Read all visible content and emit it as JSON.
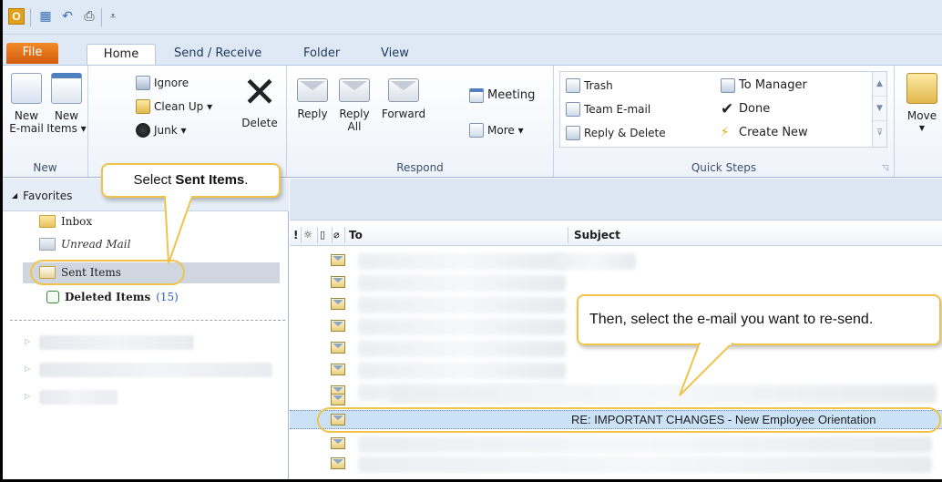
{
  "tabs": [
    "File",
    "Home",
    "Send / Receive",
    "Folder",
    "View"
  ],
  "ribbon": {
    "new": {
      "label": "New",
      "new_email": [
        "New",
        "E-mail"
      ],
      "new_items": [
        "New",
        "Items ▾"
      ]
    },
    "delete": {
      "ignore": "Ignore",
      "clean_up": "Clean Up ▾",
      "junk": "Junk ▾",
      "delete": "Delete"
    },
    "respond": {
      "label": "Respond",
      "reply": "Reply",
      "reply_all": [
        "Reply",
        "All"
      ],
      "forward": "Forward",
      "meeting": "Meeting",
      "more": "More ▾"
    },
    "quick_steps": {
      "label": "Quick Steps",
      "items": [
        "Trash",
        "Team E-mail",
        "Reply & Delete",
        "To Manager",
        "Done",
        "Create New"
      ]
    },
    "move": {
      "label": "Move"
    }
  },
  "nav": {
    "favorites": "Favorites",
    "inbox": "Inbox",
    "unread": "Unread Mail",
    "sent": "Sent Items",
    "deleted": "Deleted Items",
    "deleted_count": "(15)"
  },
  "list": {
    "col_to": "To",
    "col_subject": "Subject",
    "selected_subject": "RE: IMPORTANT CHANGES - New Employee Orientation"
  },
  "callouts": {
    "first_prefix": "Select ",
    "first_bold": "Sent Items",
    "first_suffix": ".",
    "second": "Then, select the e-mail you want to re-send."
  },
  "colors": {
    "file_tab": "#d35b0b",
    "callout_border": "#f0c34a",
    "selected_row": "#cbe1f5"
  }
}
